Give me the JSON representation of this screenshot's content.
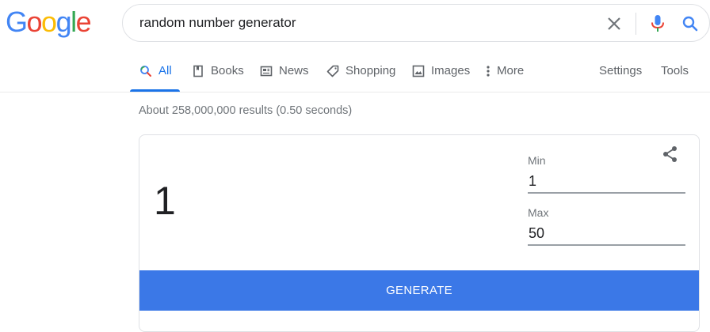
{
  "logo": {
    "letters": [
      "G",
      "o",
      "o",
      "g",
      "l",
      "e"
    ],
    "colors": [
      "#4285F4",
      "#EA4335",
      "#FBBC05",
      "#4285F4",
      "#34A853",
      "#EA4335"
    ]
  },
  "search": {
    "query": "random number generator"
  },
  "icons": {
    "clear": "close-icon",
    "mic": "microphone-icon",
    "search": "search-icon",
    "share": "share-icon"
  },
  "tabs": [
    {
      "label": "All",
      "icon": "search-icon",
      "active": true
    },
    {
      "label": "Books",
      "icon": "book-icon"
    },
    {
      "label": "News",
      "icon": "newspaper-icon"
    },
    {
      "label": "Shopping",
      "icon": "tag-icon"
    },
    {
      "label": "Images",
      "icon": "image-icon"
    },
    {
      "label": "More",
      "icon": "more-vert-icon"
    }
  ],
  "right_tabs": [
    {
      "label": "Settings"
    },
    {
      "label": "Tools"
    }
  ],
  "stats": "About 258,000,000 results (0.50 seconds)",
  "generator": {
    "result": "1",
    "min_label": "Min",
    "min_value": "1",
    "max_label": "Max",
    "max_value": "50",
    "button_label": "GENERATE"
  },
  "colors": {
    "accent": "#1a73e8",
    "button": "#3b78e7"
  }
}
